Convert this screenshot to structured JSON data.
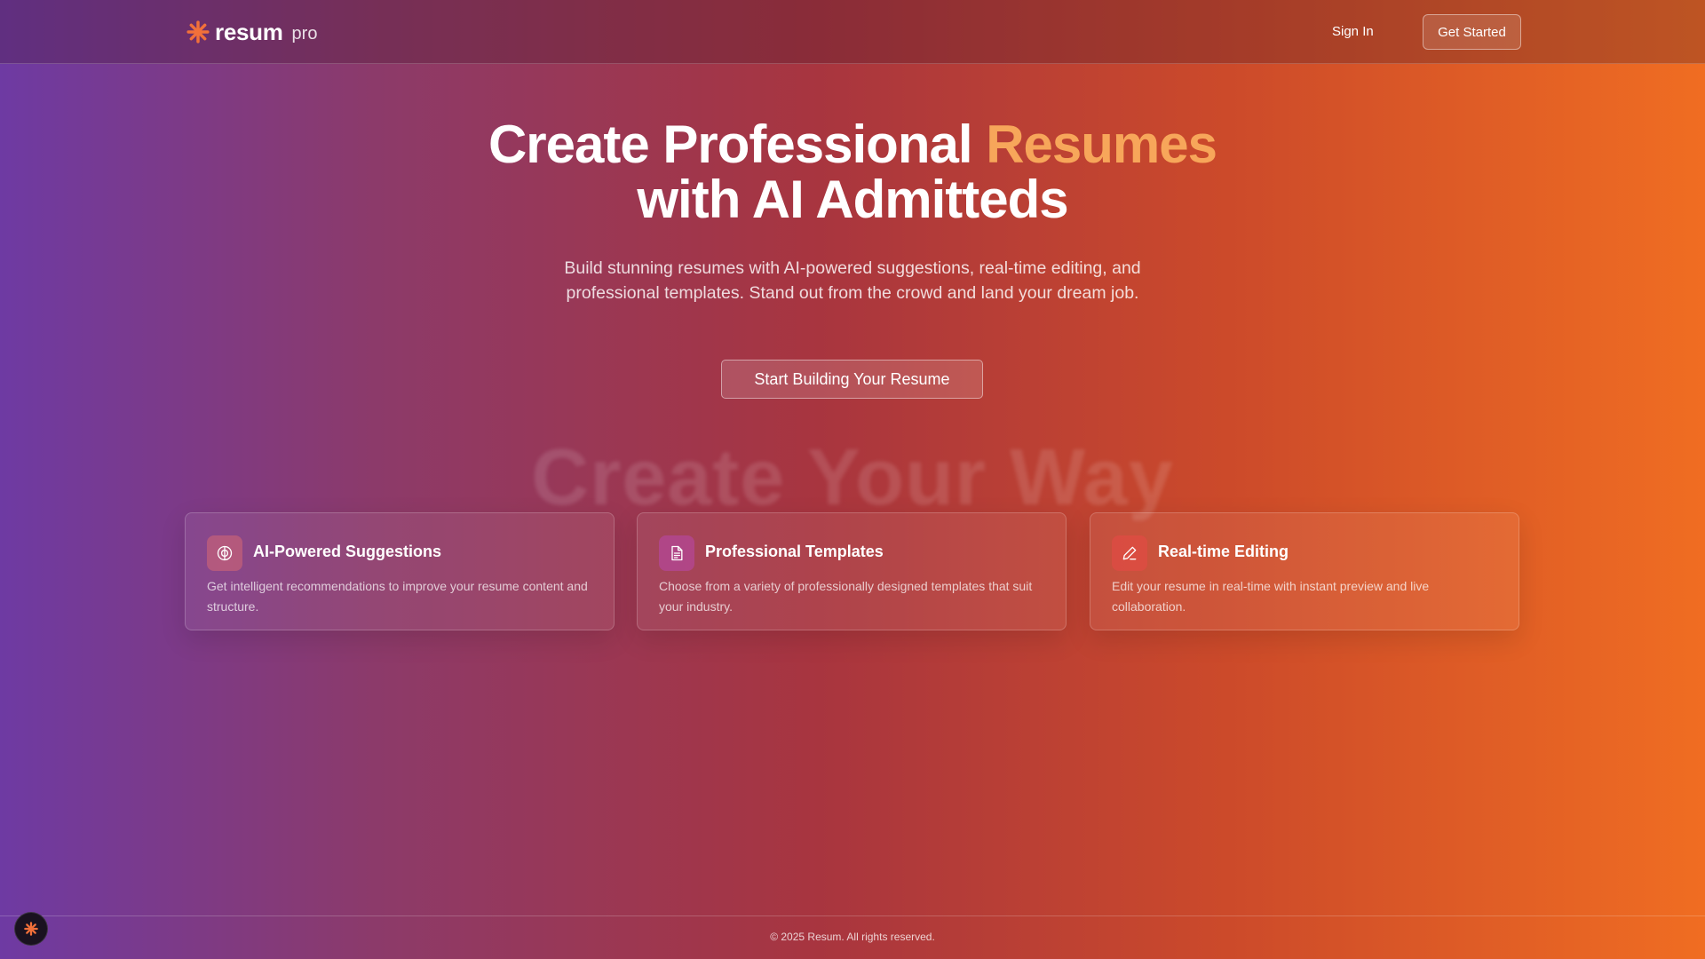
{
  "header": {
    "brand": "resum",
    "brand_suffix": "pro",
    "signin_label": "Sign In",
    "get_started_label": "Get Started"
  },
  "hero": {
    "title_part1": "Create Professional ",
    "title_accent": "Resumes",
    "title_part2": "with AI Admitteds",
    "subtitle": "Build stunning resumes with AI-powered suggestions, real-time editing, and professional templates. Stand out from the crowd and land your dream job.",
    "cta_label": "Start Building Your Resume",
    "ghost_heading": "Create Your Way"
  },
  "features": [
    {
      "icon": "brain-icon",
      "title": "AI-Powered Suggestions",
      "description": "Get intelligent recommendations to improve your resume content and structure."
    },
    {
      "icon": "document-icon",
      "title": "Professional Templates",
      "description": "Choose from a variety of professionally designed templates that suit your industry."
    },
    {
      "icon": "pencil-icon",
      "title": "Real-time Editing",
      "description": "Edit your resume in real-time with instant preview and live collaboration."
    }
  ],
  "footer": {
    "copyright": "© 2025 Resum. All rights reserved."
  },
  "colors": {
    "brand_accent": "#f2703a",
    "title_accent": "#f7a65a",
    "gradient_start": "#6e3aa3",
    "gradient_end": "#f06d22"
  }
}
